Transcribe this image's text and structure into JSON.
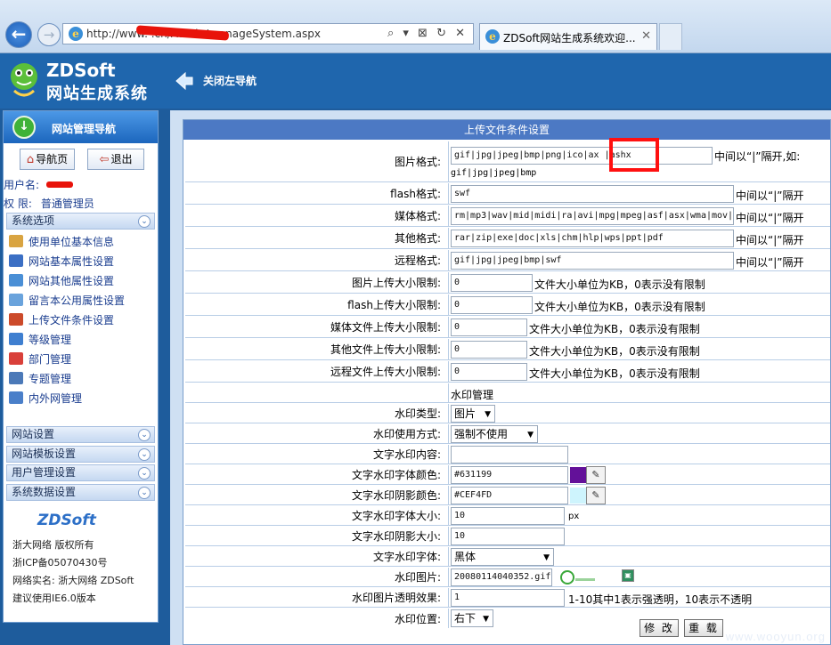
{
  "browser": {
    "url": "http://www.            .cn/Admin/manageSystem.aspx",
    "tab_title": "ZDSoft网站生成系统欢迎...",
    "address_icons": "⌕ ▾ ⊠ ↻ ✕"
  },
  "header": {
    "logo_title": "ZDSoft",
    "logo_subtitle": "网站生成系统",
    "close_nav": "关闭左导航"
  },
  "sidebar": {
    "title": "网站管理导航",
    "home_button": "导航页",
    "logout_button": "退出",
    "user_label": "用户名:",
    "role_label": "权 限:",
    "role_value": "普通管理员",
    "sections": {
      "system_options": "系统选项",
      "site_settings": "网站设置",
      "template_settings": "网站模板设置",
      "user_settings": "用户管理设置",
      "data_settings": "系统数据设置"
    },
    "items": [
      {
        "label": "使用单位基本信息",
        "icon": "box-icon",
        "color": "#d9a441"
      },
      {
        "label": "网站基本属性设置",
        "icon": "window-icon",
        "color": "#3b6fc4"
      },
      {
        "label": "网站其他属性设置",
        "icon": "network-icon",
        "color": "#4a8fd6"
      },
      {
        "label": "留言本公用属性设置",
        "icon": "note-icon",
        "color": "#6aa3dc"
      },
      {
        "label": "上传文件条件设置",
        "icon": "upload-icon",
        "color": "#cc4a2a"
      },
      {
        "label": "等级管理",
        "icon": "rank-icon",
        "color": "#3f7fd0"
      },
      {
        "label": "部门管理",
        "icon": "heart-icon",
        "color": "#d9403a"
      },
      {
        "label": "专题管理",
        "icon": "topic-icon",
        "color": "#4b79b8"
      },
      {
        "label": "内外网管理",
        "icon": "monitor-icon",
        "color": "#4a7fc9"
      }
    ],
    "footer": {
      "logo": "ZDSoft",
      "copyright": "浙大网络 版权所有",
      "icp": "浙ICP备05070430号",
      "realname": "网络实名: 浙大网络 ZDSoft",
      "suggest": "建议使用IE6.0版本"
    }
  },
  "form": {
    "title": "上传文件条件设置",
    "separator_hint": "中间以“|”隔开",
    "size_hint": "文件大小单位为KB，0表示没有限制",
    "image_format": {
      "label": "图片格式:",
      "value": "gif|jpg|jpeg|bmp|png|ico|ax |ashx",
      "hint": "中间以“|”隔开,如:",
      "example": "gif|jpg|jpeg|bmp"
    },
    "flash_format": {
      "label": "flash格式:",
      "value": "swf"
    },
    "media_format": {
      "label": "媒体格式:",
      "value": "rm|mp3|wav|mid|midi|ra|avi|mpg|mpeg|asf|asx|wma|mov|"
    },
    "other_format": {
      "label": "其他格式:",
      "value": "rar|zip|exe|doc|xls|chm|hlp|wps|ppt|pdf"
    },
    "remote_format": {
      "label": "远程格式:",
      "value": "gif|jpg|jpeg|bmp|swf"
    },
    "image_size": {
      "label": "图片上传大小限制:",
      "value": "0"
    },
    "flash_size": {
      "label": "flash上传大小限制:",
      "value": "0"
    },
    "media_size": {
      "label": "媒体文件上传大小限制:",
      "value": "0"
    },
    "other_size": {
      "label": "其他文件上传大小限制:",
      "value": "0"
    },
    "remote_size": {
      "label": "远程文件上传大小限制:",
      "value": "0"
    },
    "watermark_section": "水印管理",
    "wm_type": {
      "label": "水印类型:",
      "value": "图片"
    },
    "wm_mode": {
      "label": "水印使用方式:",
      "value": "强制不使用"
    },
    "wm_text": {
      "label": "文字水印内容:",
      "value": ""
    },
    "wm_font_color": {
      "label": "文字水印字体颜色:",
      "value": "#631199",
      "color": "#631199"
    },
    "wm_shadow_color": {
      "label": "文字水印阴影颜色:",
      "value": "#CEF4FD",
      "color": "#CEF4FD"
    },
    "wm_font_size": {
      "label": "文字水印字体大小:",
      "value": "10",
      "unit": "px"
    },
    "wm_shadow_size": {
      "label": "文字水印阴影大小:",
      "value": "10"
    },
    "wm_font": {
      "label": "文字水印字体:",
      "value": "黑体"
    },
    "wm_image": {
      "label": "水印图片:",
      "value": "20080114040352.gif"
    },
    "wm_alpha": {
      "label": "水印图片透明效果:",
      "value": "1",
      "hint": "1-10其中1表示强透明，10表示不透明"
    },
    "wm_position": {
      "label": "水印位置:",
      "value": "右下"
    },
    "edit_button": "修 改",
    "reset_button": "重 载"
  },
  "watermark_text": "www.wooyun.org"
}
